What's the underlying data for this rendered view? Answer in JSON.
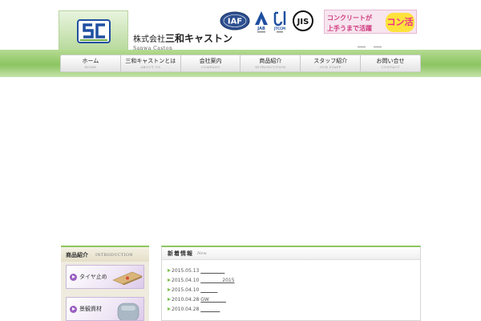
{
  "company": {
    "name_prefix": "株式会社",
    "name_main": "三和キャストン",
    "name_en": "Sanwa Caston"
  },
  "certifications": [
    "IAF",
    "JAB",
    "JTCCM",
    "JIS"
  ],
  "banner": {
    "line1": "コンクリートが",
    "line2": "上手うまで活躍",
    "bubble": "コン活"
  },
  "nav": [
    {
      "label": "ホーム",
      "sub": "HOME"
    },
    {
      "label": "三和キャストンとは",
      "sub": "ABOUT US"
    },
    {
      "label": "会社案内",
      "sub": "COMPANY"
    },
    {
      "label": "商品紹介",
      "sub": "INTRODUCTION"
    },
    {
      "label": "スタッフ紹介",
      "sub": "OUR STAFF"
    },
    {
      "label": "お問い合せ",
      "sub": "CONTACT"
    }
  ],
  "sidebar": {
    "title": "商品紹介",
    "title_en": "INTRODUCTION",
    "items": [
      {
        "label": "タイヤ止め"
      },
      {
        "label": "景観資材"
      }
    ]
  },
  "news": {
    "title": "新着情報",
    "title_en": "New",
    "items": [
      {
        "date": "2015.05.13",
        "title": "__________"
      },
      {
        "date": "2015.04.10",
        "title": "_________2015"
      },
      {
        "date": "2015.04.10",
        "title": "_______"
      },
      {
        "date": "2010.04.28",
        "title": "GW_______"
      },
      {
        "date": "2010.04.28",
        "title": "________"
      }
    ]
  },
  "colors": {
    "brand_green": "#8cc561",
    "logo_blue": "#1f4fa0",
    "banner_pink": "#d0397f",
    "category_purple": "#9b5fc0"
  }
}
